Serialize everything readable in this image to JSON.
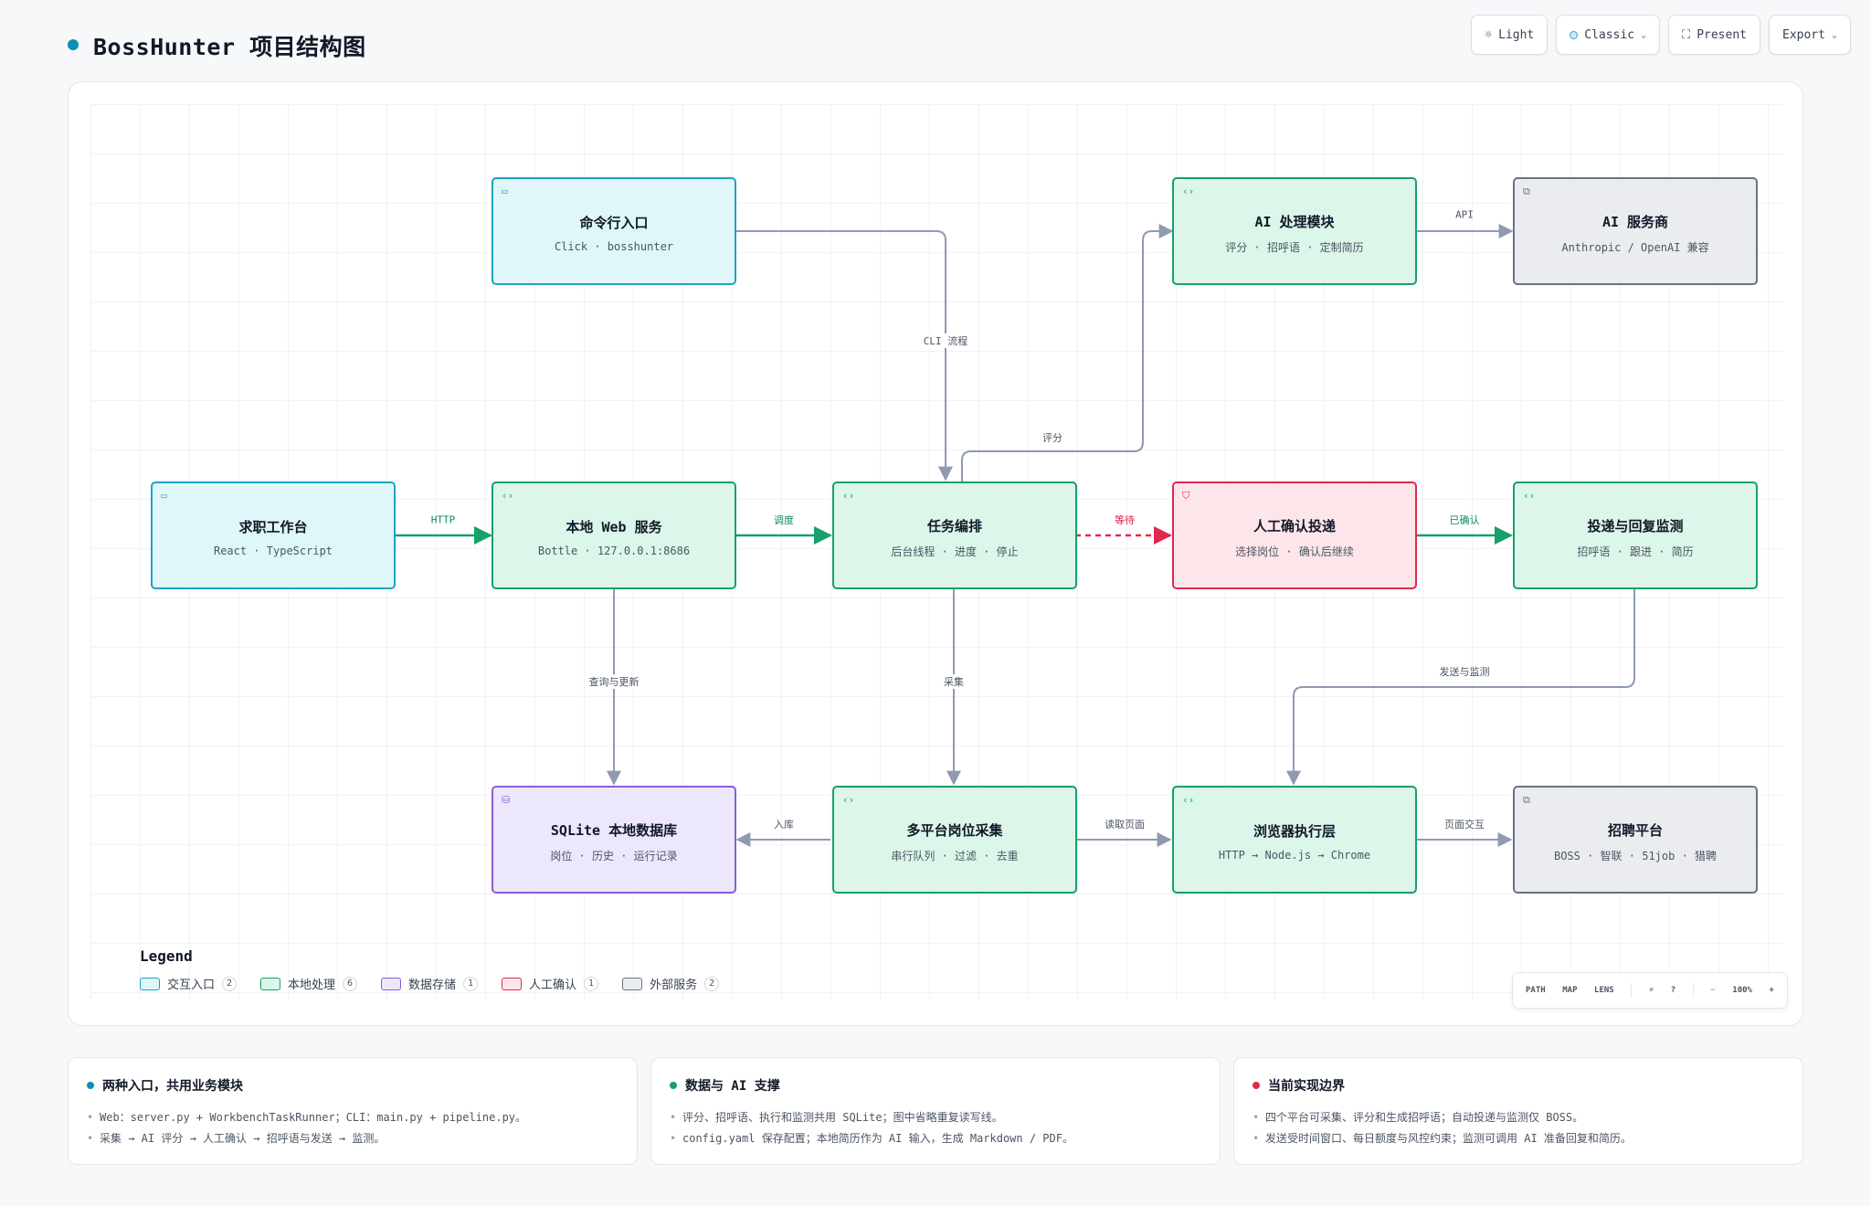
{
  "header": {
    "title": "BossHunter 项目结构图"
  },
  "toolbar": {
    "light_label": "Light",
    "theme_label": "Classic",
    "present_label": "Present",
    "export_label": "Export"
  },
  "nodes": {
    "cli": {
      "title": "命令行入口",
      "sub": "Click · bosshunter",
      "icon": "window-icon"
    },
    "ai_module": {
      "title": "AI 处理模块",
      "sub": "评分 · 招呼语 · 定制简历",
      "icon": "code-icon"
    },
    "ai_provider": {
      "title": "AI 服务商",
      "sub": "Anthropic / OpenAI 兼容",
      "icon": "external-link-icon"
    },
    "workbench": {
      "title": "求职工作台",
      "sub": "React · TypeScript",
      "icon": "window-icon"
    },
    "web": {
      "title": "本地 Web 服务",
      "sub": "Bottle · 127.0.0.1:8686",
      "icon": "code-icon"
    },
    "orchestrator": {
      "title": "任务编排",
      "sub": "后台线程 · 进度 · 停止",
      "icon": "code-icon"
    },
    "confirm": {
      "title": "人工确认投递",
      "sub": "选择岗位 · 确认后继续",
      "icon": "shield-icon"
    },
    "monitor": {
      "title": "投递与回复监测",
      "sub": "招呼语 · 跟进 · 简历",
      "icon": "code-icon"
    },
    "sqlite": {
      "title": "SQLite 本地数据库",
      "sub": "岗位 · 历史 · 运行记录",
      "icon": "database-icon"
    },
    "collect": {
      "title": "多平台岗位采集",
      "sub": "串行队列 · 过滤 · 去重",
      "icon": "code-icon"
    },
    "browser": {
      "title": "浏览器执行层",
      "sub": "HTTP → Node.js → Chrome",
      "icon": "code-icon"
    },
    "platforms": {
      "title": "招聘平台",
      "sub": "BOSS · 智联 · 51job · 猎聘",
      "icon": "external-link-icon"
    }
  },
  "edges": {
    "cli_flow": "CLI 流程",
    "api": "API",
    "score": "评分",
    "http": "HTTP",
    "dispatch": "调度",
    "wait": "等待",
    "confirmed": "已确认",
    "query_update": "查询与更新",
    "collect": "采集",
    "send_monitor": "发送与监测",
    "store": "入库",
    "read_page": "读取页面",
    "page_interact": "页面交互"
  },
  "legend": {
    "title": "Legend",
    "items": [
      {
        "label": "交互入口",
        "count": "2",
        "fill": "#e0f7fa",
        "stroke": "#1fa2c3"
      },
      {
        "label": "本地处理",
        "count": "6",
        "fill": "#dcf6ea",
        "stroke": "#16a06a"
      },
      {
        "label": "数据存储",
        "count": "1",
        "fill": "#ede7fb",
        "stroke": "#8b5cd6"
      },
      {
        "label": "人工确认",
        "count": "1",
        "fill": "#fde6ea",
        "stroke": "#e0284d"
      },
      {
        "label": "外部服务",
        "count": "2",
        "fill": "#eaecf0",
        "stroke": "#6b7280"
      }
    ]
  },
  "minibar": {
    "path": "PATH",
    "map": "MAP",
    "lens": "LENS",
    "zoom": "100%",
    "minus": "−",
    "plus": "+"
  },
  "info_cards": [
    {
      "title": "两种入口，共用业务模块",
      "color": "#0891b2",
      "lines": [
        "Web：server.py + WorkbenchTaskRunner；CLI：main.py + pipeline.py。",
        "采集 → AI 评分 → 人工确认 → 招呼语与发送 → 监测。"
      ]
    },
    {
      "title": "数据与 AI 支撑",
      "color": "#16a06a",
      "lines": [
        "评分、招呼语、执行和监测共用 SQLite；图中省略重复读写线。",
        "config.yaml 保存配置；本地简历作为 AI 输入，生成 Markdown / PDF。"
      ]
    },
    {
      "title": "当前实现边界",
      "color": "#e0284d",
      "lines": [
        "四个平台可采集、评分和生成招呼语；自动投递与监测仅 BOSS。",
        "发送受时间窗口、每日额度与风控约束；监测可调用 AI 准备回复和简历。"
      ]
    }
  ]
}
